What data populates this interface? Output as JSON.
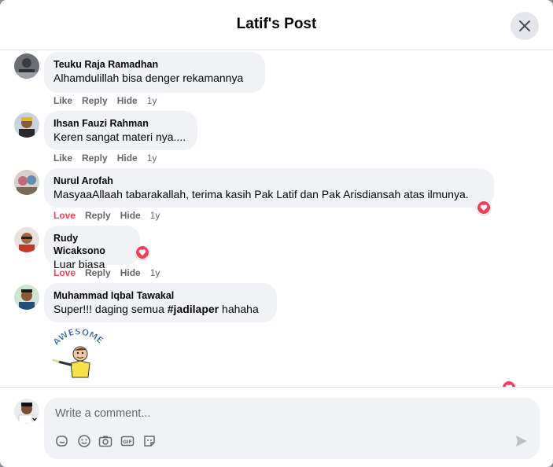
{
  "header": {
    "title": "Latif's Post",
    "close_icon": "close-icon"
  },
  "colors": {
    "love": "#f33e58",
    "bubble": "#f0f2f5",
    "muted": "#65676b"
  },
  "comments": [
    {
      "author": "Teuku Raja Ramadhan",
      "text": "Alhamdulillah bisa denger rekamannya",
      "actions": [
        "Like",
        "Reply",
        "Hide"
      ],
      "time": "1y"
    },
    {
      "author": "Ihsan Fauzi Rahman",
      "text": "Keren sangat materi nya....",
      "actions": [
        "Like",
        "Reply",
        "Hide"
      ],
      "time": "1y"
    },
    {
      "author": "Nurul Arofah",
      "text": "MasyaaAllaah tabarakallah, terima kasih Pak Latif dan Pak Arisdiansah atas ilmunya.",
      "actions": [
        "Love",
        "Reply",
        "Hide"
      ],
      "time": "1y",
      "reaction": "heart-icon"
    },
    {
      "author": "Rudy Wicaksono",
      "text": "Luar biasa",
      "actions": [
        "Love",
        "Reply",
        "Hide"
      ],
      "time": "1y",
      "reaction": "heart-icon"
    },
    {
      "author": "Muhammad Iqbal Tawakal",
      "text_prefix": "Super!!! daging semua ",
      "hashtag": "#jadilaper",
      "text_suffix": " hahaha",
      "sticker_text": "AWESOME"
    }
  ],
  "composer": {
    "placeholder": "Write a comment...",
    "tools": [
      "sticker-icon",
      "emoji-icon",
      "camera-icon",
      "gif-icon",
      "sticker-face-icon"
    ],
    "send_icon": "send-icon"
  }
}
